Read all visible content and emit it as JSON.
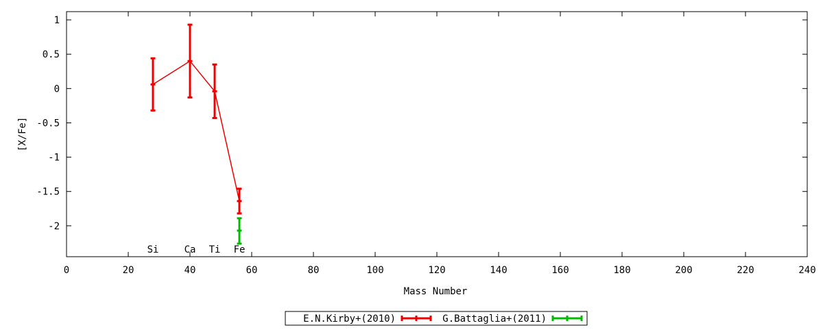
{
  "chart_data": {
    "type": "scatter",
    "title": "",
    "xlabel": "Mass Number",
    "ylabel": "[X/Fe]",
    "xlim": [
      0,
      240
    ],
    "ylim": [
      -2.45,
      1.12
    ],
    "x_ticks": [
      0,
      20,
      40,
      60,
      80,
      100,
      120,
      140,
      160,
      180,
      200,
      220,
      240
    ],
    "x_tick_labels": [
      "0",
      "20",
      "40",
      "60",
      "80",
      "100",
      "120",
      "140",
      "160",
      "180",
      "200",
      "220",
      "240"
    ],
    "y_ticks": [
      1,
      0.5,
      0,
      -0.5,
      -1,
      -1.5,
      -2
    ],
    "y_tick_labels": [
      "1",
      "0.5",
      "0",
      "-0.5",
      "-1",
      "-1.5",
      "-2"
    ],
    "grid": false,
    "legend_position": "bottom-center",
    "element_labels": [
      {
        "text": "Si",
        "x": 28
      },
      {
        "text": "Ca",
        "x": 40
      },
      {
        "text": "Ti",
        "x": 48
      },
      {
        "text": "Fe",
        "x": 56
      }
    ],
    "series": [
      {
        "name": "E.N.Kirby+(2010)",
        "color": "#ee0000",
        "connected": true,
        "points": [
          {
            "x": 28,
            "y": 0.06,
            "ylow": -0.32,
            "yhigh": 0.44
          },
          {
            "x": 40,
            "y": 0.4,
            "ylow": -0.13,
            "yhigh": 0.93
          },
          {
            "x": 48,
            "y": -0.04,
            "ylow": -0.43,
            "yhigh": 0.35
          },
          {
            "x": 56,
            "y": -1.64,
            "ylow": -1.82,
            "yhigh": -1.46
          }
        ]
      },
      {
        "name": "G.Battaglia+(2011)",
        "color": "#00bb00",
        "connected": false,
        "points": [
          {
            "x": 56,
            "y": -2.07,
            "ylow": -2.26,
            "yhigh": -1.89
          }
        ]
      }
    ]
  }
}
